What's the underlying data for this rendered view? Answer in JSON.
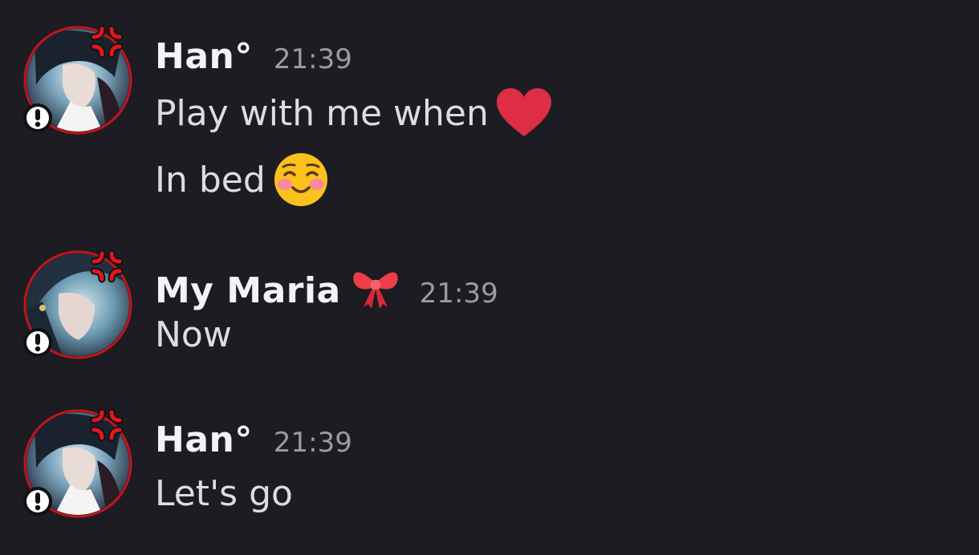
{
  "messages": [
    {
      "username": "Han°",
      "timestamp": "21:39",
      "avatar_icon": "avatar-han",
      "lines": [
        {
          "text": "Play with me when",
          "emoji": "heart-icon"
        },
        {
          "text": "In bed",
          "emoji": "smiling-blush-face-icon"
        }
      ]
    },
    {
      "username": "My Maria",
      "username_emoji": "ribbon-bow-icon",
      "timestamp": "21:39",
      "avatar_icon": "avatar-maria",
      "lines": [
        {
          "text": "Now"
        }
      ]
    },
    {
      "username": "Han°",
      "timestamp": "21:39",
      "avatar_icon": "avatar-han",
      "lines": [
        {
          "text": "Let's go"
        }
      ]
    }
  ],
  "colors": {
    "background": "#1c1c22",
    "username": "#f2f3f5",
    "message_text": "#dbdee1",
    "timestamp": "#9a9ca4",
    "avatar_ring": "#c4141c",
    "heart": "#dd2e44"
  }
}
